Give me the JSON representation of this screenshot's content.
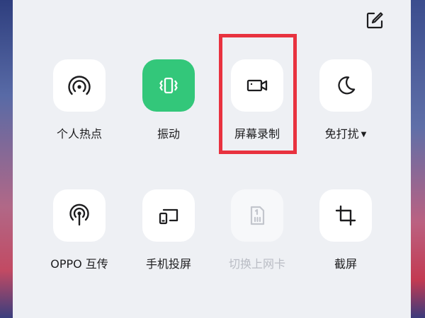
{
  "colors": {
    "active_tile": "#33c77a",
    "highlight": "#e8323f",
    "panel": "#eef0f4"
  },
  "header": {
    "edit_icon": "edit-square-icon"
  },
  "tiles_row1": [
    {
      "label": "个人热点",
      "icon": "hotspot-icon"
    },
    {
      "label": "振动",
      "icon": "vibrate-icon",
      "active": true
    },
    {
      "label": "屏幕录制",
      "icon": "screen-record-icon",
      "highlighted": true
    },
    {
      "label": "免打扰",
      "icon": "moon-icon",
      "has_dropdown": true
    }
  ],
  "tiles_row2": [
    {
      "label": "OPPO 互传",
      "icon": "share-antenna-icon"
    },
    {
      "label": "手机投屏",
      "icon": "screen-cast-icon"
    },
    {
      "label": "切换上网卡",
      "icon": "sim-card-icon",
      "disabled": true
    },
    {
      "label": "截屏",
      "icon": "crop-icon"
    }
  ]
}
